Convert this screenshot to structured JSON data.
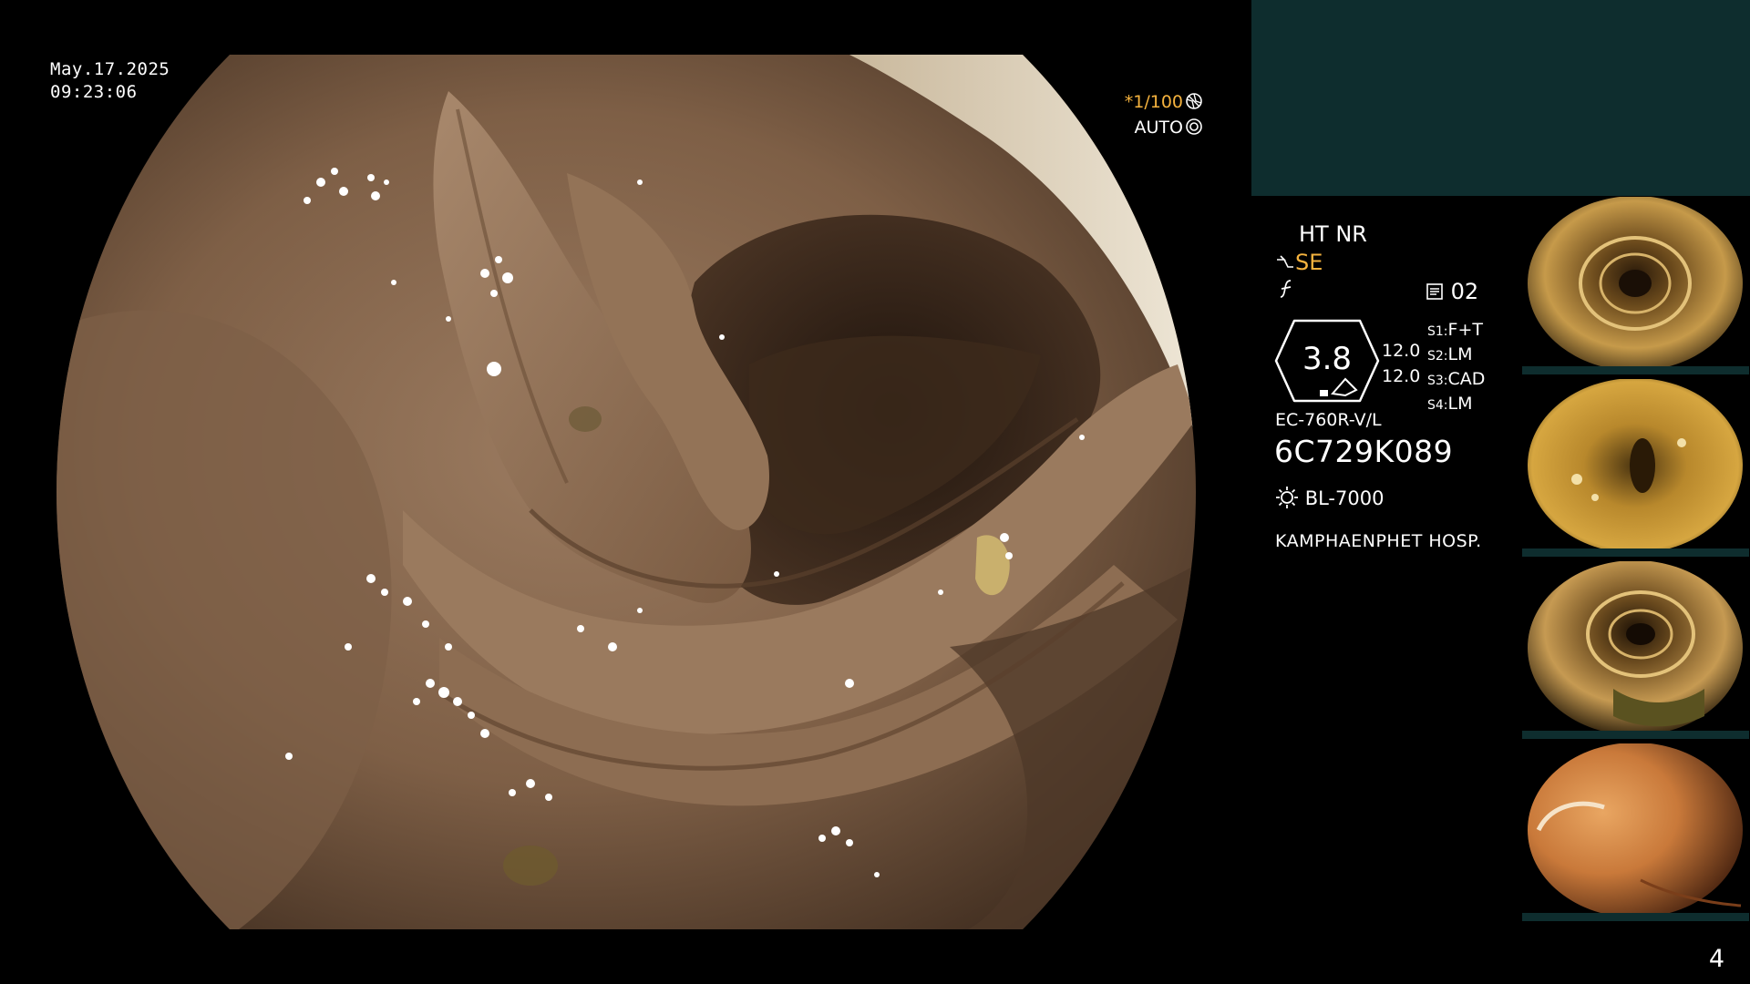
{
  "overlay": {
    "date": "May.17.2025",
    "time": "09:23:06",
    "shutter_prefix": "*",
    "shutter_value": "1/100",
    "exposure_mode": "AUTO"
  },
  "panel": {
    "ht_nr": "HT NR",
    "se_label": "SE",
    "memo_value": "02",
    "gauge_value": "3.8",
    "gain_values": [
      "12.0",
      "12.0"
    ],
    "s_settings": [
      {
        "key": "S1:",
        "value": "F+T"
      },
      {
        "key": "S2:",
        "value": "LM"
      },
      {
        "key": "S3:",
        "value": "CAD"
      },
      {
        "key": "S4:",
        "value": "LM"
      }
    ],
    "scope_model": "EC-760R-V/L",
    "scope_serial": "6C729K089",
    "light_source": "BL-7000",
    "hospital": "KAMPHAENPHET HOSP."
  },
  "page_number": "4",
  "colors": {
    "accent_orange": "#f4b23e",
    "panel_top": "#0e2d2e",
    "mucosa": "#8a6a4f"
  },
  "icons": [
    "shutter-icon",
    "auto-exposure-icon",
    "structure-enhance-icon",
    "freeze-icon",
    "memo-icon",
    "light-source-icon"
  ]
}
